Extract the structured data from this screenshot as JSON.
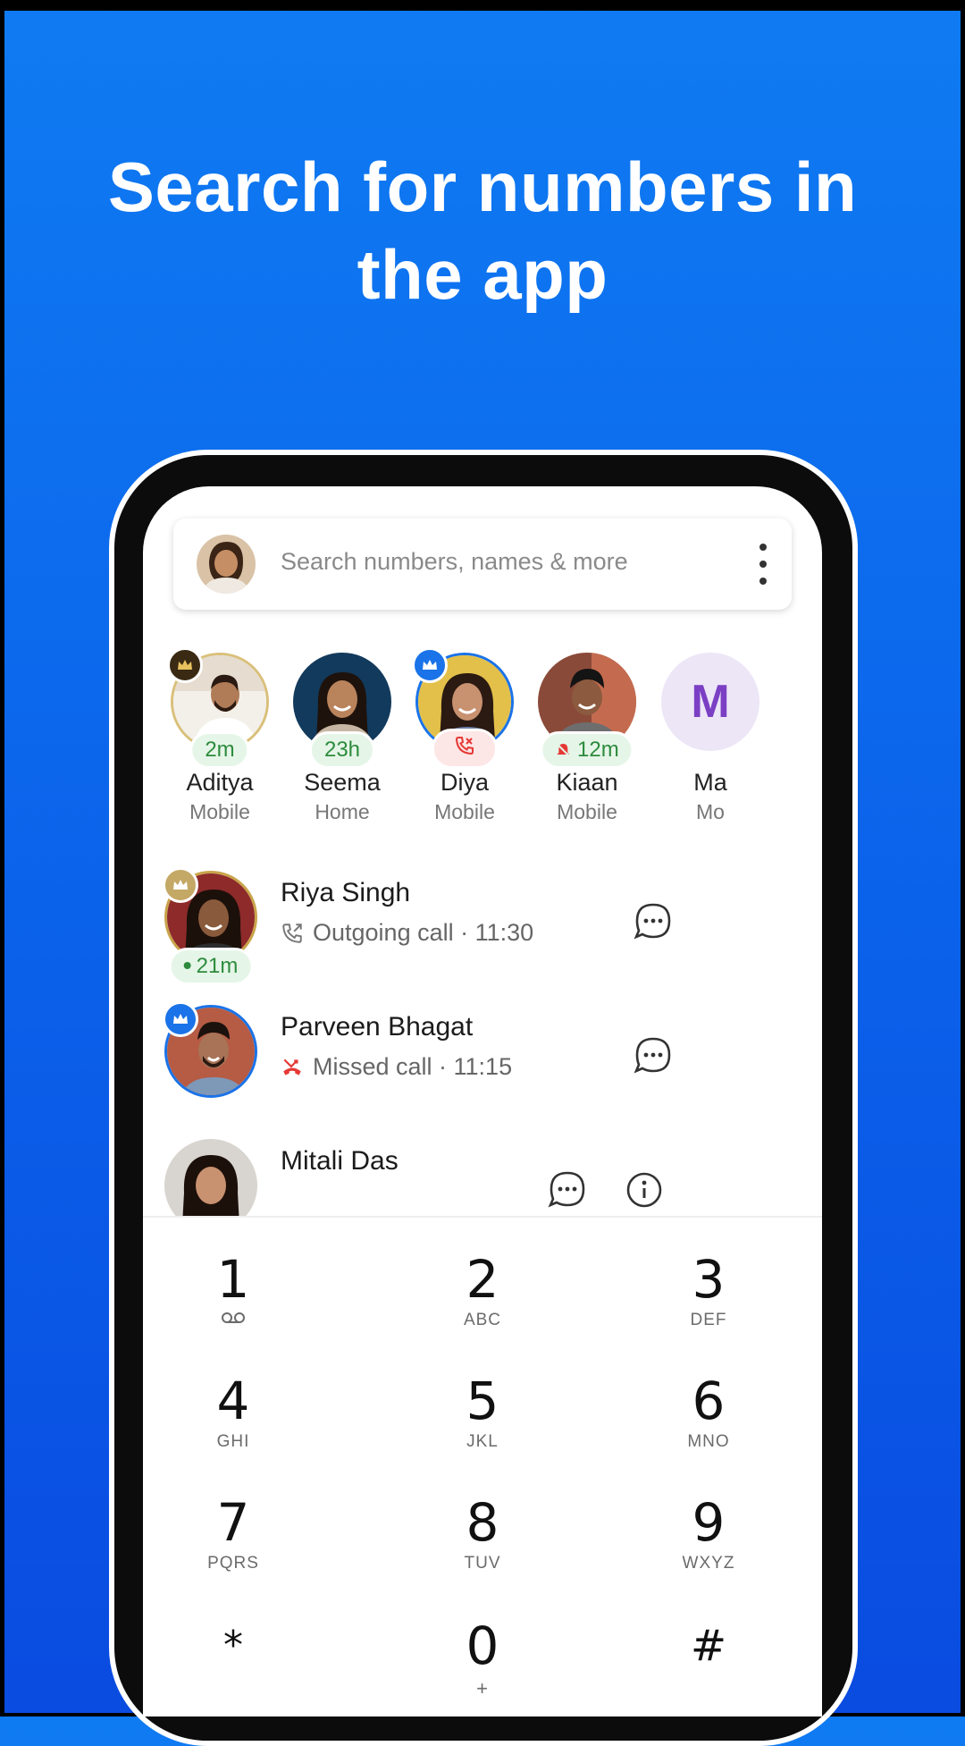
{
  "headline": {
    "line1": "Search for numbers in",
    "line2": "the app"
  },
  "search": {
    "placeholder": "Search numbers, names & more"
  },
  "favorites": [
    {
      "name": "Aditya",
      "type": "Mobile",
      "pill": "2m",
      "badge": "crown-gold"
    },
    {
      "name": "Seema",
      "type": "Home",
      "pill": "23h",
      "badge": ""
    },
    {
      "name": "Diya",
      "type": "Mobile",
      "pill": "",
      "badge": "crown-blue",
      "status": "call-icon-red"
    },
    {
      "name": "Kiaan",
      "type": "Mobile",
      "pill": "12m",
      "badge": "",
      "status": "muted-bell-icon"
    },
    {
      "name": "Ma",
      "type": "Mo",
      "initial": "M"
    }
  ],
  "calls": [
    {
      "name": "Riya Singh",
      "detail": "Outgoing call · 11:30",
      "pill": "21m",
      "badge": "crown-gold"
    },
    {
      "name": "Parveen Bhagat",
      "detail": "Missed call · 11:15",
      "badge": "crown-blue"
    },
    {
      "name": "Mitali Das",
      "detail": ""
    }
  ],
  "dialpad": [
    {
      "digit": "1",
      "letters": ""
    },
    {
      "digit": "2",
      "letters": "ABC"
    },
    {
      "digit": "3",
      "letters": "DEF"
    },
    {
      "digit": "4",
      "letters": "GHI"
    },
    {
      "digit": "5",
      "letters": "JKL"
    },
    {
      "digit": "6",
      "letters": "MNO"
    },
    {
      "digit": "7",
      "letters": "PQRS"
    },
    {
      "digit": "8",
      "letters": "TUV"
    },
    {
      "digit": "9",
      "letters": "WXYZ"
    },
    {
      "digit": "*",
      "letters": ""
    },
    {
      "digit": "0",
      "letters": "+"
    },
    {
      "digit": "#",
      "letters": ""
    }
  ],
  "colors": {
    "background": "#0b61ea",
    "accent_green": "#2e8b3d",
    "missed_red": "#e53935",
    "crown_gold": "#8a6a2e",
    "crown_blue": "#1a73e8"
  }
}
